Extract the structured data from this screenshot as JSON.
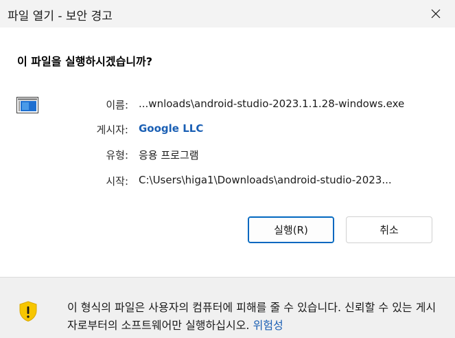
{
  "window": {
    "title": "파일 열기 - 보안 경고",
    "close_icon": "close-icon"
  },
  "prompt": {
    "heading": "이 파일을 실행하시겠습니까?"
  },
  "file_info": {
    "app_icon": "application-window-icon",
    "name_label": "이름:",
    "name_value": "...wnloads\\android-studio-2023.1.1.28-windows.exe",
    "publisher_label": "게시자:",
    "publisher_value": "Google LLC",
    "type_label": "유형:",
    "type_value": "응용 프로그램",
    "from_label": "시작:",
    "from_value": "C:\\Users\\higa1\\Downloads\\android-studio-2023..."
  },
  "buttons": {
    "run": "실행(R)",
    "cancel": "취소"
  },
  "warning": {
    "icon": "shield-warning-icon",
    "text": "이 형식의 파일은 사용자의 컴퓨터에 피해를 줄 수 있습니다. 신뢰할 수 있는 게시자로부터의 소프트웨어만 실행하십시오. ",
    "link": "위험성"
  },
  "colors": {
    "link": "#1a5fb4",
    "accent": "#0067c0",
    "shield": "#f7c600"
  }
}
